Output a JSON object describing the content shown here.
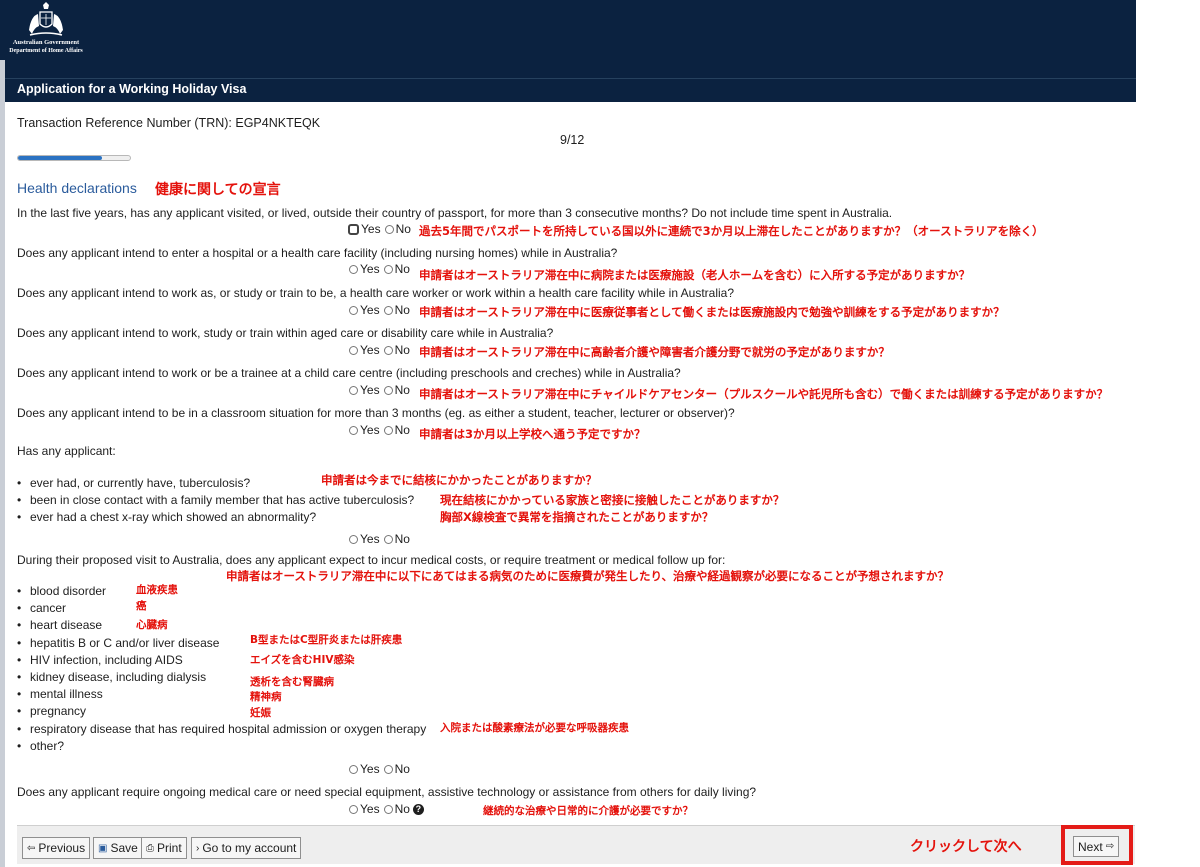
{
  "header": {
    "gov_line1": "Australian Government",
    "gov_line2": "Department of Home Affairs",
    "title": "Application for a Working Holiday Visa"
  },
  "trn_text": "Transaction Reference Number (TRN): EGP4NKTEQK",
  "page_number": "9/12",
  "progress_fraction": 0.75,
  "section_title": "Health declarations",
  "section_title_jp": "健康に関しての宣言",
  "labels": {
    "yes": "Yes",
    "no": "No"
  },
  "questions": {
    "q1": "In the last five years, has any applicant visited, or lived, outside their country of passport, for more than 3 consecutive months? Do not include time spent in Australia.",
    "q1_jp": "過去5年間でパスポートを所持している国以外に連続で3か月以上滞在したことがありますか？（オーストラリアを除く）",
    "q2": "Does any applicant intend to enter a hospital or a health care facility (including nursing homes) while in Australia?",
    "q2_jp": "申請者はオーストラリア滞在中に病院または医療施設（老人ホームを含む）に入所する予定がありますか？",
    "q3": "Does any applicant intend to work as, or study or train to be, a health care worker or work within a health care facility while in Australia?",
    "q3_jp": "申請者はオーストラリア滞在中に医療従事者として働くまたは医療施設内で勉強や訓練をする予定がありますか？",
    "q4": "Does any applicant intend to work, study or train within aged care or disability care while in Australia?",
    "q4_jp": "申請者はオーストラリア滞在中に高齢者介護や障害者介護分野で就労の予定がありますか？",
    "q5": "Does any applicant intend to work or be a trainee at a child care centre (including preschools and creches) while in Australia?",
    "q5_jp": "申請者はオーストラリア滞在中にチャイルドケアセンター（プルスクールや託児所も含む）で働くまたは訓練する予定がありますか？",
    "q6": "Does any applicant intend to be in a classroom situation for more than 3 months (eg. as either a student, teacher, lecturer or observer)?",
    "q6_jp": "申請者は3か月以上学校へ通う予定ですか？",
    "q7_intro": "Has any applicant:",
    "q7_items": [
      "ever had, or currently have, tuberculosis?",
      "been in close contact with a family member that has active tuberculosis?",
      "ever had a chest x-ray which showed an abnormality?"
    ],
    "q7_items_jp": [
      "申請者は今までに結核にかかったことがありますか？",
      "現在結核にかかっている家族と密接に接触したことがありますか？",
      "胸部X線検査で異常を指摘されたことがありますか？"
    ],
    "q8_intro": "During their proposed visit to Australia, does any applicant expect to incur medical costs, or require treatment or medical follow up for:",
    "q8_intro_jp": "申請者はオーストラリア滞在中に以下にあてはまる病気のために医療費が発生したり、治療や経過観察が必要になることが予想されますか？",
    "q8_items": [
      "blood disorder",
      "cancer",
      "heart disease",
      "hepatitis B or C and/or liver disease",
      "HIV infection, including AIDS",
      "kidney disease, including dialysis",
      "mental illness",
      "pregnancy",
      "respiratory disease that has required hospital admission or oxygen therapy",
      "other?"
    ],
    "q8_items_jp": [
      "血液疾患",
      "癌",
      "心臓病",
      "B型またはC型肝炎または肝疾患",
      "エイズを含むHIV感染",
      "透析を含む腎臓病",
      "精神病",
      "妊娠",
      "入院または酸素療法が必要な呼吸器疾患"
    ],
    "q9": "Does any applicant require ongoing medical care or need special equipment, assistive technology or assistance from others for daily living?",
    "q9_jp": "継続的な治療や日常的に介護が必要ですか？"
  },
  "footer": {
    "previous": "Previous",
    "save": "Save",
    "print": "Print",
    "account": "Go to my account",
    "next": "Next",
    "next_jp": "クリックして次へ"
  }
}
